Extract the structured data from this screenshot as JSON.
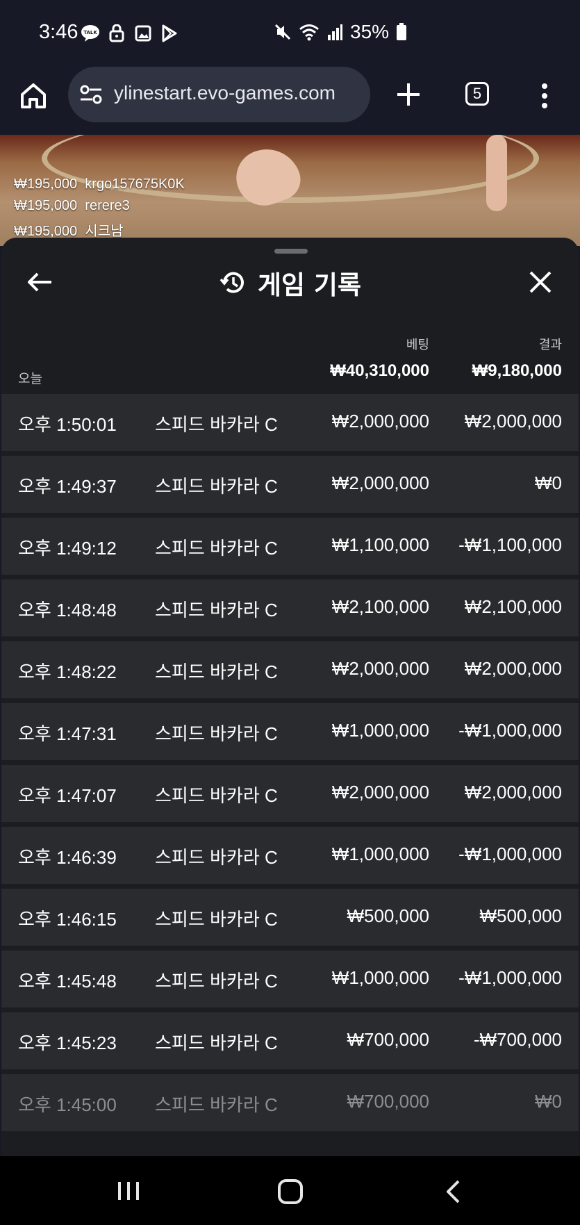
{
  "status_bar": {
    "time": "3:46",
    "battery": "35%",
    "icons_left": [
      "talk-icon",
      "lock-icon",
      "gallery-icon",
      "play-store-icon"
    ],
    "icons_right": [
      "mute-icon",
      "wifi-icon",
      "signal-icon",
      "battery-icon"
    ]
  },
  "browser": {
    "url": "ylinestart.evo-games.com",
    "tab_count": "5"
  },
  "video_overlay": {
    "bets": [
      {
        "amount": "₩195,000",
        "user": "krgo157675K0K"
      },
      {
        "amount": "₩195,000",
        "user": "rerere3"
      },
      {
        "amount": "₩195,000",
        "user": "시크남"
      }
    ]
  },
  "panel": {
    "title": "게임 기록",
    "columns": {
      "bet": "베팅",
      "result": "결과"
    },
    "today_label": "오늘",
    "total_bet": "₩40,310,000",
    "total_result": "₩9,180,000",
    "rows": [
      {
        "time": "오후 1:50:01",
        "game": "스피드 바카라 C",
        "bet": "₩2,000,000",
        "result": "₩2,000,000"
      },
      {
        "time": "오후 1:49:37",
        "game": "스피드 바카라 C",
        "bet": "₩2,000,000",
        "result": "₩0"
      },
      {
        "time": "오후 1:49:12",
        "game": "스피드 바카라 C",
        "bet": "₩1,100,000",
        "result": "-₩1,100,000"
      },
      {
        "time": "오후 1:48:48",
        "game": "스피드 바카라 C",
        "bet": "₩2,100,000",
        "result": "₩2,100,000"
      },
      {
        "time": "오후 1:48:22",
        "game": "스피드 바카라 C",
        "bet": "₩2,000,000",
        "result": "₩2,000,000"
      },
      {
        "time": "오후 1:47:31",
        "game": "스피드 바카라 C",
        "bet": "₩1,000,000",
        "result": "-₩1,000,000"
      },
      {
        "time": "오후 1:47:07",
        "game": "스피드 바카라 C",
        "bet": "₩2,000,000",
        "result": "₩2,000,000"
      },
      {
        "time": "오후 1:46:39",
        "game": "스피드 바카라 C",
        "bet": "₩1,000,000",
        "result": "-₩1,000,000"
      },
      {
        "time": "오후 1:46:15",
        "game": "스피드 바카라 C",
        "bet": "₩500,000",
        "result": "₩500,000"
      },
      {
        "time": "오후 1:45:48",
        "game": "스피드 바카라 C",
        "bet": "₩1,000,000",
        "result": "-₩1,000,000"
      },
      {
        "time": "오후 1:45:23",
        "game": "스피드 바카라 C",
        "bet": "₩700,000",
        "result": "-₩700,000"
      },
      {
        "time": "오후 1:45:00",
        "game": "스피드 바카라 C",
        "bet": "₩700,000",
        "result": "₩0"
      }
    ]
  },
  "nav_bar": {
    "buttons": [
      "recents-icon",
      "home-icon",
      "back-icon"
    ]
  },
  "colors": {
    "background": "#171a26",
    "panel": "#1c1d20",
    "row": "#2a2b2e"
  }
}
